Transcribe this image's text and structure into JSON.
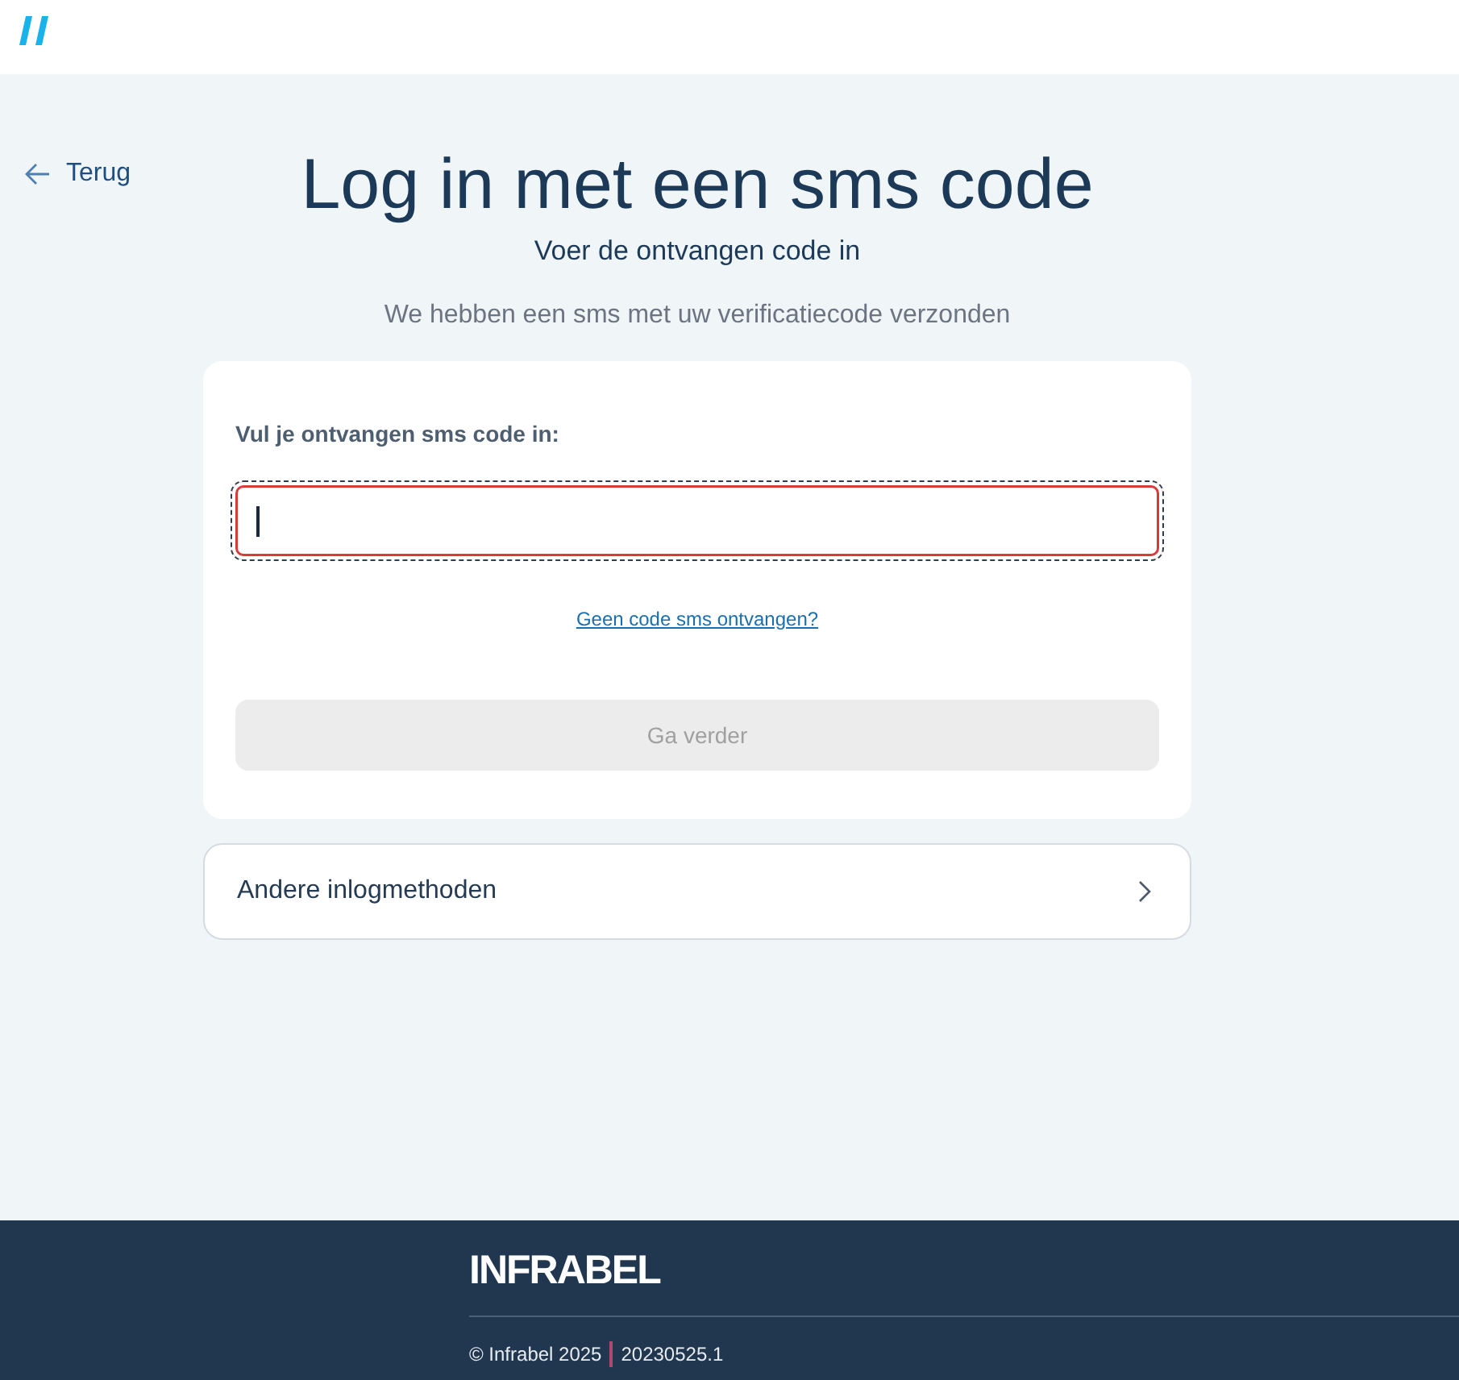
{
  "back_link": {
    "label": "Terug"
  },
  "title": "Log in met een sms code",
  "subtitle": "Voer de ontvangen code in",
  "notice": "We hebben een sms met uw verificatiecode verzonden",
  "form": {
    "label": "Vul je ontvangen sms code in:",
    "code_field": {
      "focused": true,
      "error": true
    },
    "resend_link": "Geen code sms ontvangen?",
    "submit_button": {
      "label": "Ga verder",
      "disabled": true
    }
  },
  "other_methods": {
    "label": "Andere inlogmethoden"
  },
  "footer": {
    "logo": "INFRABEL",
    "copyright": "© Infrabel 2025",
    "version": "20230525.1"
  }
}
